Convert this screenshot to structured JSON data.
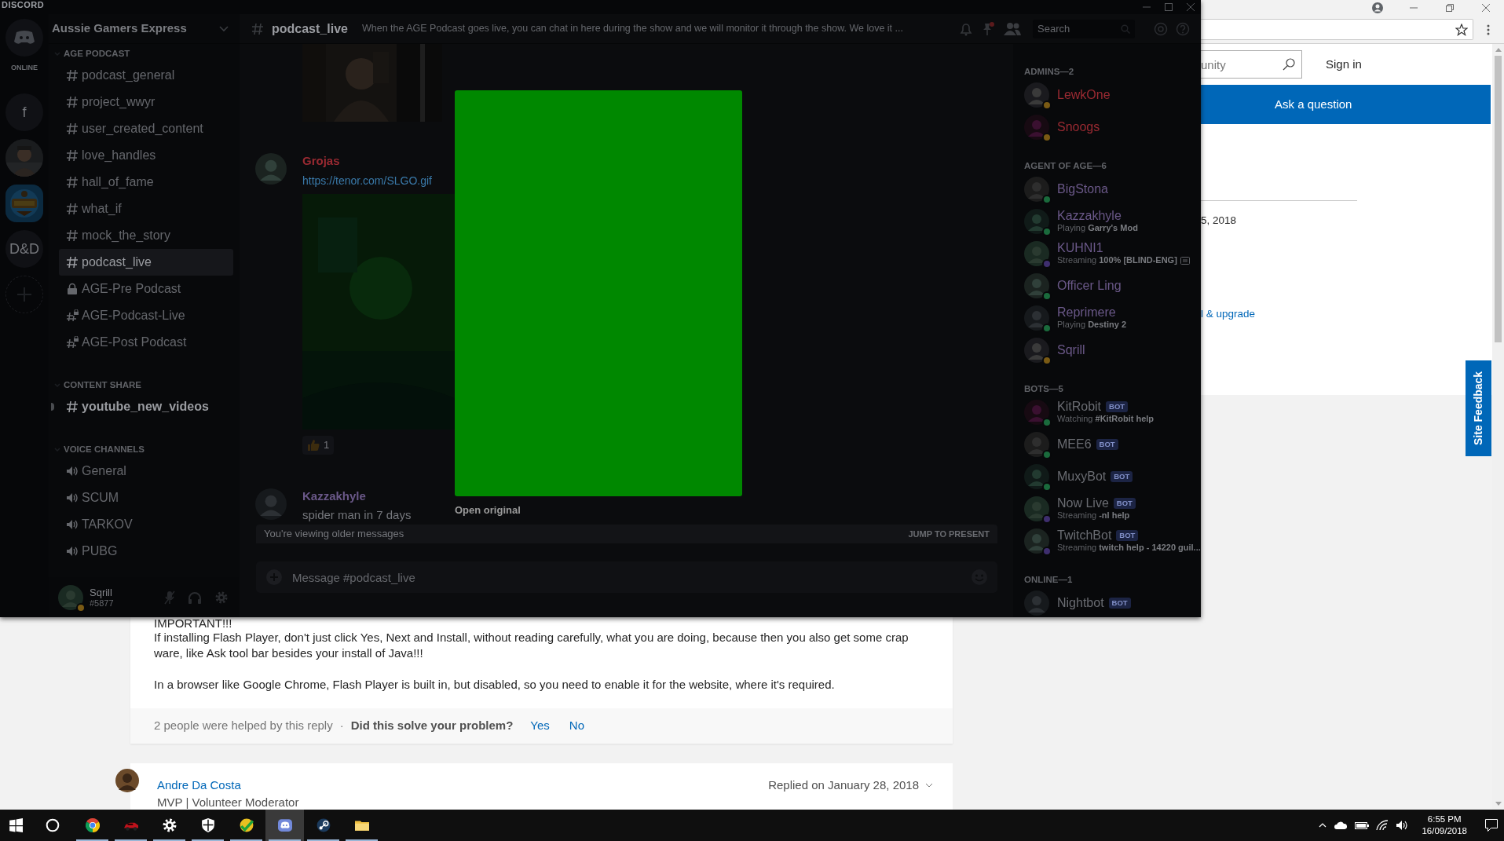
{
  "discord": {
    "app_title": "DISCORD",
    "servers": [
      {
        "kind": "home",
        "caption": "ONLINE",
        "selected": false
      },
      {
        "kind": "letter",
        "label": "f",
        "selected": false
      },
      {
        "kind": "picture",
        "selected": false
      },
      {
        "kind": "picture",
        "selected": true
      },
      {
        "kind": "letter",
        "label": "D&D",
        "selected": false
      },
      {
        "kind": "add",
        "selected": false
      }
    ],
    "guild_name": "Aussie Gamers Express",
    "categories": [
      {
        "name": "AGE PODCAST",
        "channels": [
          {
            "kind": "text",
            "name": "podcast_general",
            "selected": false,
            "unread": false
          },
          {
            "kind": "text",
            "name": "project_wwyr",
            "selected": false,
            "unread": false
          },
          {
            "kind": "text",
            "name": "user_created_content",
            "selected": false,
            "unread": false
          },
          {
            "kind": "text",
            "name": "love_handles",
            "selected": false,
            "unread": false
          },
          {
            "kind": "text",
            "name": "hall_of_fame",
            "selected": false,
            "unread": false
          },
          {
            "kind": "text",
            "name": "what_if",
            "selected": false,
            "unread": false
          },
          {
            "kind": "text",
            "name": "mock_the_story",
            "selected": false,
            "unread": false
          },
          {
            "kind": "text",
            "name": "podcast_live",
            "selected": true,
            "unread": false
          },
          {
            "kind": "locked",
            "name": "AGE-Pre Podcast",
            "selected": false,
            "unread": false
          },
          {
            "kind": "text_locked",
            "name": "AGE-Podcast-Live",
            "selected": false,
            "unread": false
          },
          {
            "kind": "text_locked",
            "name": "AGE-Post Podcast",
            "selected": false,
            "unread": false
          }
        ]
      },
      {
        "name": "CONTENT SHARE",
        "channels": [
          {
            "kind": "text",
            "name": "youtube_new_videos",
            "selected": false,
            "unread": true
          }
        ]
      },
      {
        "name": "VOICE CHANNELS",
        "channels": [
          {
            "kind": "voice",
            "name": "General",
            "selected": false,
            "unread": false
          },
          {
            "kind": "voice",
            "name": "SCUM",
            "selected": false,
            "unread": false
          },
          {
            "kind": "voice",
            "name": "TARKOV",
            "selected": false,
            "unread": false
          },
          {
            "kind": "voice",
            "name": "PUBG",
            "selected": false,
            "unread": false
          }
        ]
      }
    ],
    "user": {
      "name": "Sqrill",
      "tag": "#5877",
      "status": {
        "color": "#7a5a14"
      }
    },
    "channel": {
      "name": "podcast_live",
      "topic": "When the AGE Podcast goes live, you can chat in here during the show and we will monitor it through the show. We love it ...",
      "search": {
        "placeholder": "Search"
      }
    },
    "messages": [
      {
        "kind": "attachment"
      },
      {
        "kind": "link_message",
        "author": "Grojas",
        "color": "#9a2a32",
        "link": "https://tenor.com/SLGO.gif",
        "reactions": [
          {
            "count": "1"
          }
        ]
      },
      {
        "kind": "message",
        "author": "Kazzakhyle",
        "color": "#6a5888",
        "text": "spider man in 7 days"
      }
    ],
    "older_bar": {
      "text": "You're viewing older messages",
      "action": "JUMP TO PRESENT"
    },
    "composer": {
      "placeholder": "Message #podcast_live"
    },
    "lightbox": {
      "action": "Open original"
    },
    "member_groups": [
      {
        "title": "ADMINS—2",
        "members": [
          {
            "name": "LewkOne",
            "color": "#9a2a32",
            "status": {
              "color": "#7a5a14"
            }
          },
          {
            "name": "Snoogs",
            "color": "#9a2a32",
            "status": {
              "color": "#7a5a14"
            }
          }
        ]
      },
      {
        "title": "AGENT OF AGE—6",
        "members": [
          {
            "name": "BigStona",
            "color": "#6a5888",
            "status": {
              "color": "#1a6a3c"
            }
          },
          {
            "name": "Kazzakhyle",
            "color": "#6a5888",
            "status": {
              "color": "#1a6a3c"
            },
            "activity": "Playing **Garry's Mod**"
          },
          {
            "name": "KUHNI1",
            "color": "#6a5888",
            "status": {
              "color": "#3e2e6e"
            },
            "activity": "Streaming **100% [BLIND-ENG]**",
            "activity_icon": true
          },
          {
            "name": "Officer Ling",
            "color": "#6a5888",
            "status": {
              "color": "#1a6a3c"
            }
          },
          {
            "name": "Reprimere",
            "color": "#6a5888",
            "status": {
              "color": "#1a6a3c"
            },
            "activity": "Playing **Destiny 2**"
          },
          {
            "name": "Sqrill",
            "color": "#6a5888",
            "status": {
              "color": "#7a5a14"
            }
          }
        ]
      },
      {
        "title": "BOTS—5",
        "members": [
          {
            "name": "KitRobit",
            "color": "#6a6c72",
            "tag": "BOT",
            "status": {
              "color": "#1a6a3c"
            },
            "activity": "Watching **#KitRobit help**"
          },
          {
            "name": "MEE6",
            "color": "#6a6c72",
            "tag": "BOT",
            "status": {
              "color": "#1a6a3c"
            }
          },
          {
            "name": "MuxyBot",
            "color": "#6a6c72",
            "tag": "BOT",
            "status": {
              "color": "#1a6a3c"
            }
          },
          {
            "name": "Now Live",
            "color": "#6a6c72",
            "tag": "BOT",
            "status": {
              "color": "#3e2e6e"
            },
            "activity": "Streaming **-nl help**"
          },
          {
            "name": "TwitchBot",
            "color": "#6a6c72",
            "tag": "BOT",
            "status": {
              "color": "#3e2e6e"
            },
            "activity": "Streaming **twitch help - 14220 guil...**"
          }
        ]
      },
      {
        "title": "ONLINE—1",
        "members": [
          {
            "name": "Nightbot",
            "color": "#6a6c72",
            "tag": "BOT"
          }
        ]
      }
    ]
  },
  "browser": {
    "search": {
      "placeholder": "unity"
    },
    "sign_in": "Sign in",
    "ask": "Ask a question",
    "date": "5, 2018",
    "link": "l & upgrade",
    "feedback": "Site Feedback",
    "reply": {
      "heading": "IMPORTANT!!!",
      "paragraphs": [
        "If installing Flash Player, don't just click Yes, Next and Install, without reading carefully, what you are doing, because then you also get some crap ware, like Ask tool bar besides your install of Java!!!",
        "In a browser like Google Chrome, Flash Player is built in, but disabled, so you need to enable it for the website, where it's required."
      ],
      "helped": "2 people were helped by this reply",
      "separator": "·",
      "question": "Did this solve your problem?",
      "answers": [
        "Yes",
        "No"
      ]
    },
    "next_reply": {
      "author": "Andre Da Costa",
      "role": "MVP | Volunteer Moderator",
      "replied": "Replied on January 28, 2018"
    }
  },
  "taskbar": {
    "apps": [
      {
        "kind": "start",
        "running": false,
        "selected": false
      },
      {
        "kind": "search",
        "running": false,
        "selected": false
      },
      {
        "kind": "chrome",
        "running": true,
        "selected": false
      },
      {
        "kind": "car",
        "running": true,
        "selected": false
      },
      {
        "kind": "settings",
        "running": true,
        "selected": false
      },
      {
        "kind": "shield",
        "running": true,
        "selected": false
      },
      {
        "kind": "check",
        "running": true,
        "selected": false
      },
      {
        "kind": "discord",
        "running": true,
        "selected": true
      },
      {
        "kind": "steam",
        "running": true,
        "selected": false
      },
      {
        "kind": "folder",
        "running": true,
        "selected": false
      }
    ],
    "time": "6:55 PM",
    "date": "16/09/2018"
  }
}
